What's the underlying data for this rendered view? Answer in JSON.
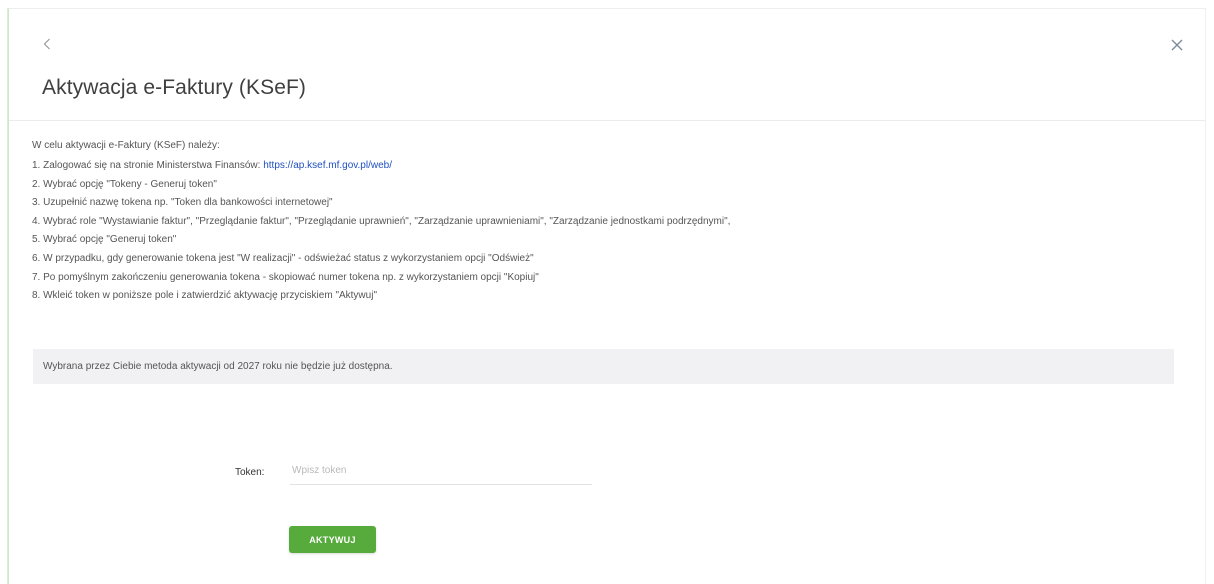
{
  "header": {
    "title": "Aktywacja e-Faktury (KSeF)",
    "back_icon": "chevron-left-icon",
    "close_icon": "close-icon"
  },
  "content": {
    "intro": "W celu aktywacji e-Faktury (KSeF) należy:",
    "steps": [
      {
        "text": "1. Zalogować się na stronie Ministerstwa Finansów: ",
        "link": "https://ap.ksef.mf.gov.pl/web/"
      },
      {
        "text": "2. Wybrać opcję \"Tokeny - Generuj token\""
      },
      {
        "text": "3. Uzupełnić nazwę tokena np. \"Token dla bankowości internetowej\""
      },
      {
        "text": "4. Wybrać role \"Wystawianie faktur\", \"Przeglądanie faktur\", \"Przeglądanie uprawnień\", \"Zarządzanie uprawnieniami\", \"Zarządzanie jednostkami podrzędnymi\","
      },
      {
        "text": "5. Wybrać opcję \"Generuj token\""
      },
      {
        "text": "6. W przypadku, gdy generowanie tokena jest \"W realizacji\" - odświeżać status z wykorzystaniem opcji \"Odśwież\""
      },
      {
        "text": "7. Po pomyślnym zakończeniu generowania tokena - skopiować numer tokena np. z wykorzystaniem opcji \"Kopiuj\""
      },
      {
        "text": "8. Wkleić token w poniższe pole i zatwierdzić aktywację przyciskiem \"Aktywuj\""
      }
    ],
    "notice": "Wybrana przez Ciebie metoda aktywacji od 2027 roku nie będzie już dostępna."
  },
  "form": {
    "token_label": "Token:",
    "token_placeholder": "Wpisz token",
    "token_value": "",
    "activate_label": "AKTYWUJ"
  },
  "colors": {
    "accent": "#57aa3c",
    "link": "#1f4fc0",
    "notice_bg": "#f1f1f3"
  }
}
